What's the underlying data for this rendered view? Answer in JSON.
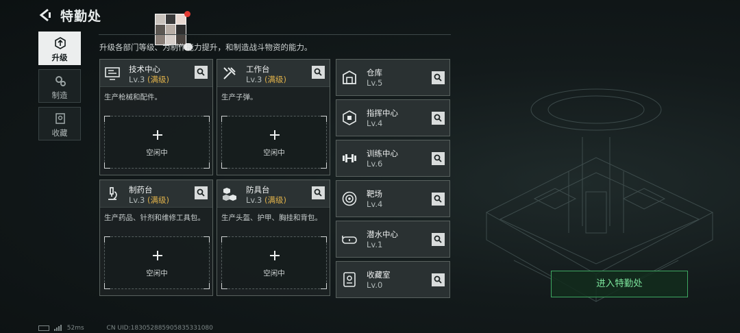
{
  "header": {
    "title": "特勤处"
  },
  "description": "升级各部门等级、为制作能力提升，和制造战斗物资的能力。",
  "nav": [
    {
      "label": "升级",
      "icon": "upgrade-icon",
      "active": true
    },
    {
      "label": "制造",
      "icon": "gears-icon",
      "active": false
    },
    {
      "label": "收藏",
      "icon": "collection-icon",
      "active": false
    }
  ],
  "workshops": [
    {
      "name": "技术中心",
      "level": "Lv.3",
      "status": "(满级)",
      "icon": "monitor-icon",
      "desc": "生产枪械和配件。",
      "slot_label": "空闲中"
    },
    {
      "name": "工作台",
      "level": "Lv.3",
      "status": "(满级)",
      "icon": "tools-icon",
      "desc": "生产子弹。",
      "slot_label": "空闲中"
    },
    {
      "name": "制药台",
      "level": "Lv.3",
      "status": "(满级)",
      "icon": "microscope-icon",
      "desc": "生产药品、针剂和维修工具包。",
      "slot_label": "空闲中"
    },
    {
      "name": "防具台",
      "level": "Lv.3",
      "status": "(满级)",
      "icon": "armor-blocks-icon",
      "desc": "生产头盔、护甲、胸挂和背包。",
      "slot_label": "空闲中"
    }
  ],
  "facilities": [
    {
      "name": "仓库",
      "level": "Lv.5",
      "icon": "warehouse-icon"
    },
    {
      "name": "指挥中心",
      "level": "Lv.4",
      "icon": "chip-icon"
    },
    {
      "name": "训练中心",
      "level": "Lv.6",
      "icon": "dumbbell-icon"
    },
    {
      "name": "靶场",
      "level": "Lv.4",
      "icon": "target-icon"
    },
    {
      "name": "潜水中心",
      "level": "Lv.1",
      "icon": "diving-mask-icon"
    },
    {
      "name": "收藏室",
      "level": "Lv.0",
      "icon": "display-case-icon"
    }
  ],
  "enter_button": "进入特勤处",
  "footer": {
    "ping": "52ms",
    "uid": "CN UID:18305288590583533108​0"
  },
  "colors": {
    "accent_green": "#7be39b",
    "max_level": "#e1b24a",
    "notification": "#e23b33"
  }
}
